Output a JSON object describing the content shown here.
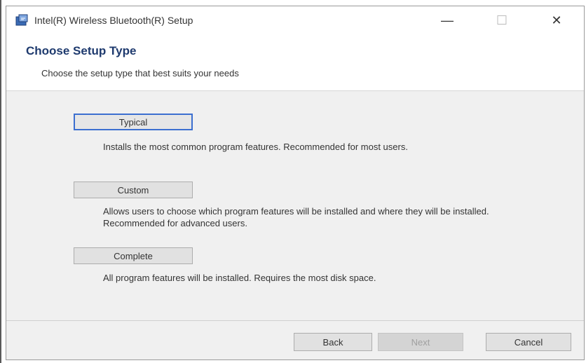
{
  "window": {
    "title": "Intel(R) Wireless Bluetooth(R) Setup",
    "minimize_glyph": "—",
    "maximize_glyph": "☐",
    "close_glyph": "✕"
  },
  "header": {
    "title": "Choose Setup Type",
    "subtitle": "Choose the setup type that best suits your needs"
  },
  "options": [
    {
      "label": "Typical",
      "description": "Installs the most common program features. Recommended for most users."
    },
    {
      "label": "Custom",
      "description": "Allows users to choose which program features will be installed and where they will be installed. Recommended for advanced users."
    },
    {
      "label": "Complete",
      "description": "All program features will be installed. Requires the most disk space."
    }
  ],
  "footer": {
    "back_label": "Back",
    "next_label": "Next",
    "cancel_label": "Cancel"
  },
  "colors": {
    "header_title": "#1e3a6e",
    "focus_border": "#3c6fd0"
  },
  "icons": {
    "app": "installer-icon"
  }
}
